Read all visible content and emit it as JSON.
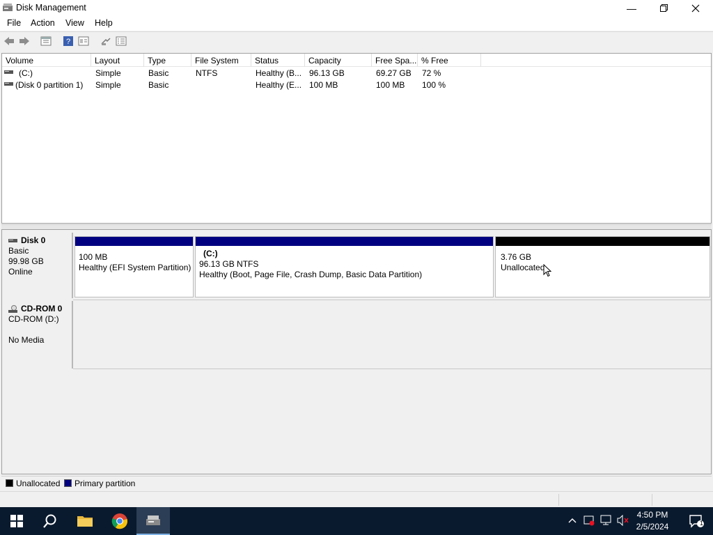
{
  "window": {
    "title": "Disk Management"
  },
  "menu": {
    "items": [
      "File",
      "Action",
      "View",
      "Help"
    ]
  },
  "volume_list": {
    "columns": [
      "Volume",
      "Layout",
      "Type",
      "File System",
      "Status",
      "Capacity",
      "Free Spa...",
      "% Free"
    ],
    "rows": [
      [
        "(C:)",
        "Simple",
        "Basic",
        "NTFS",
        "Healthy (B...",
        "96.13 GB",
        "69.27 GB",
        "72 %"
      ],
      [
        "(Disk 0 partition 1)",
        "Simple",
        "Basic",
        "",
        "Healthy (E...",
        "100 MB",
        "100 MB",
        "100 %"
      ]
    ]
  },
  "disks": [
    {
      "name": "Disk 0",
      "type": "Basic",
      "size": "99.98 GB",
      "state": "Online",
      "partitions": [
        {
          "title": "",
          "size": "100 MB",
          "status": "Healthy (EFI System Partition)",
          "kind": "primary"
        },
        {
          "title": "(C:)",
          "size": "96.13 GB NTFS",
          "status": "Healthy (Boot, Page File, Crash Dump, Basic Data Partition)",
          "kind": "primary"
        },
        {
          "title": "",
          "size": "3.76 GB",
          "status": "Unallocated",
          "kind": "unallocated"
        }
      ]
    },
    {
      "name": "CD-ROM 0",
      "type": "CD-ROM (D:)",
      "size": "",
      "state": "No Media"
    }
  ],
  "legend": [
    {
      "label": "Unallocated",
      "color": "#000000"
    },
    {
      "label": "Primary partition",
      "color": "#000080"
    }
  ],
  "taskbar": {
    "time": "4:50 PM",
    "date": "2/5/2024",
    "notification_count": "1"
  },
  "colors": {
    "primary_partition": "#000080",
    "unallocated": "#000000",
    "taskbar": "#0a1a2e"
  }
}
